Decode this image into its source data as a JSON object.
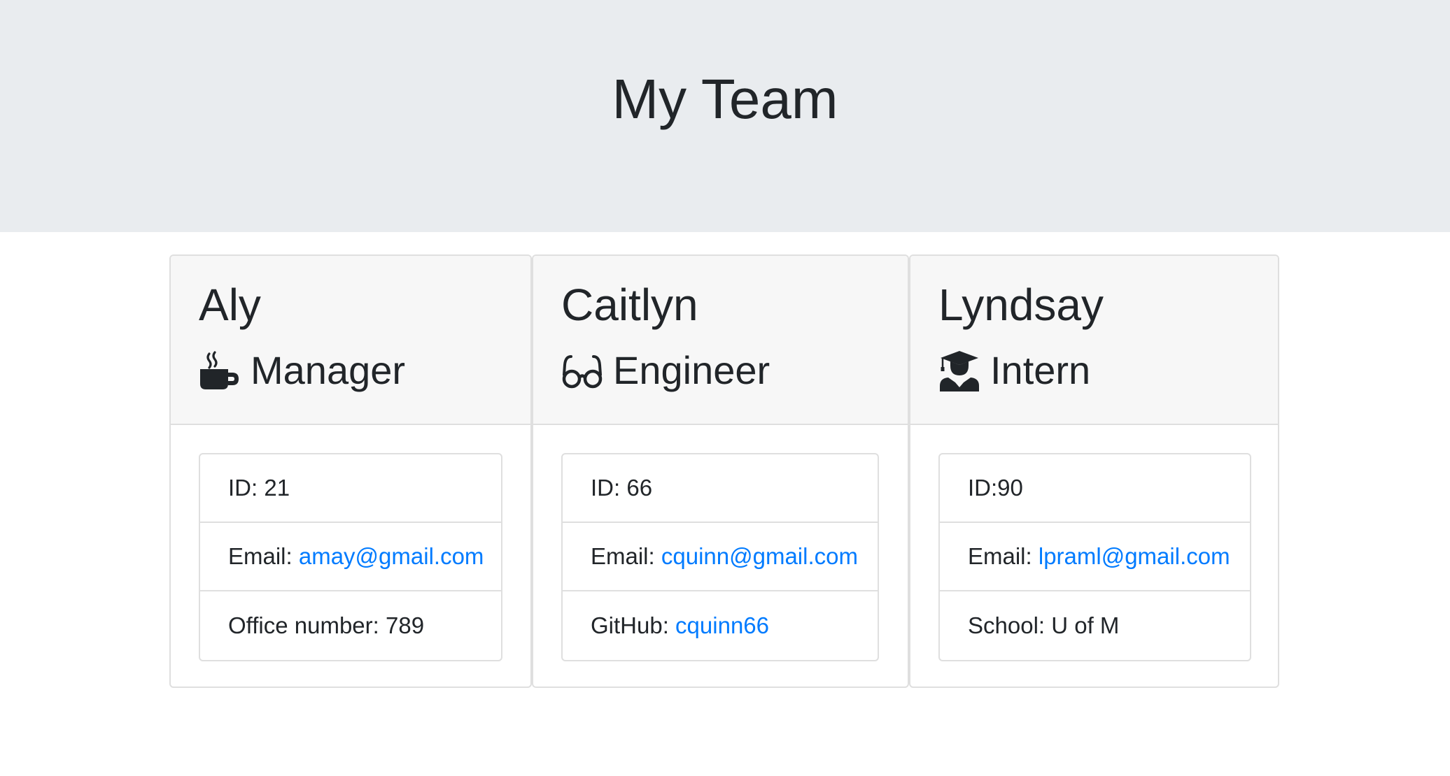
{
  "header": {
    "title": "My Team"
  },
  "cards": [
    {
      "name": "Aly",
      "role": "Manager",
      "icon": "mug-icon",
      "id_label": "ID: 21",
      "email_prefix": "Email: ",
      "email": "amay@gmail.com",
      "extra_prefix": "Office number: 789",
      "extra_link": ""
    },
    {
      "name": "Caitlyn",
      "role": "Engineer",
      "icon": "glasses-icon",
      "id_label": "ID: 66",
      "email_prefix": "Email: ",
      "email": "cquinn@gmail.com",
      "extra_prefix": "GitHub: ",
      "extra_link": "cquinn66"
    },
    {
      "name": "Lyndsay",
      "role": "Intern",
      "icon": "graduate-icon",
      "id_label": "ID:90",
      "email_prefix": "Email: ",
      "email": "lpraml@gmail.com",
      "extra_prefix": "School: U of M",
      "extra_link": ""
    }
  ],
  "colors": {
    "jumbotron_bg": "#e9ecef",
    "card_header_bg": "#f7f7f7",
    "link": "#007bff",
    "text": "#212529",
    "border": "#dfdfdf"
  }
}
